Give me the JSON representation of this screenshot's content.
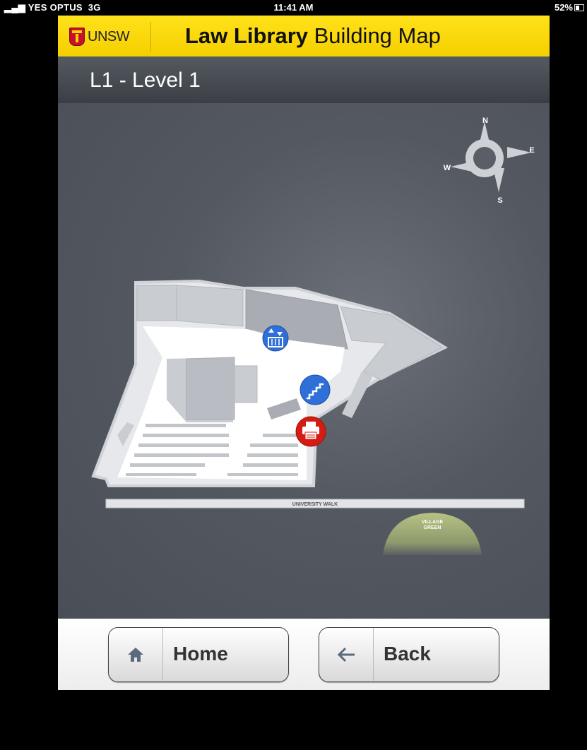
{
  "status_bar": {
    "carrier": "YES OPTUS",
    "network": "3G",
    "time": "11:41 AM",
    "battery": "52%"
  },
  "header": {
    "logo_text": "UNSW",
    "title_bold": "Law Library",
    "title_rest": "Building Map"
  },
  "level": {
    "title": "L1 - Level 1"
  },
  "map": {
    "compass": {
      "n": "N",
      "e": "E",
      "s": "S",
      "w": "W"
    },
    "street_label": "UNIVERSITY WALK",
    "green_label_line1": "VILLAGE",
    "green_label_line2": "GREEN",
    "icons": [
      "lift-icon",
      "stairs-icon",
      "printer-icon"
    ],
    "colors": {
      "lift": "#2e6fd8",
      "stairs": "#2e6fd8",
      "printer": "#d41c14",
      "header": "#ffdd00"
    }
  },
  "nav": {
    "home_label": "Home",
    "back_label": "Back"
  }
}
